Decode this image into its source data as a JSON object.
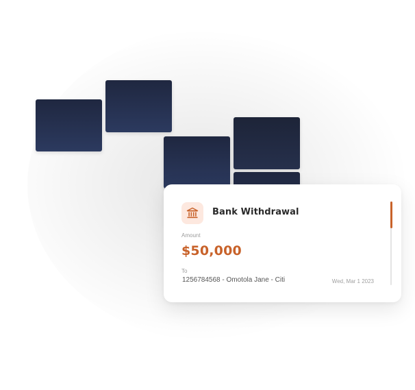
{
  "theme": {
    "accent": "#c8622a",
    "tile_color": "#26304c",
    "badge_bg": "#fde8df"
  },
  "transaction": {
    "icon": "bank-icon",
    "title": "Bank Withdrawal",
    "amount_label": "Amount",
    "amount": "$50,000",
    "to_label": "To",
    "recipient": "1256784568 - Omotola Jane - Citi",
    "date": "Wed, Mar 1 2023"
  }
}
